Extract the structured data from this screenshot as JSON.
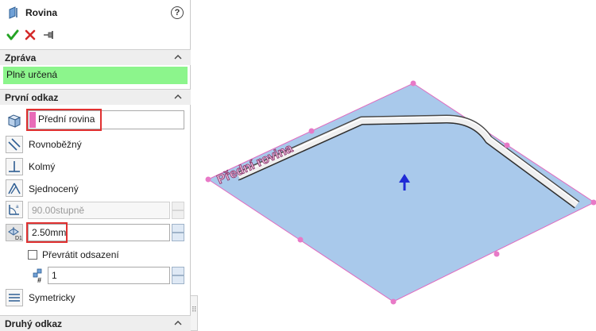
{
  "property_manager": {
    "title": "Rovina",
    "help_glyph": "?",
    "actions": {
      "ok": "✔",
      "cancel": "✖",
      "pin": "⊣"
    }
  },
  "sections": {
    "message": {
      "label": "Zpráva",
      "status_text": "Plně určená",
      "status_color": "#8cf58c"
    },
    "first_reference": {
      "label": "První odkaz",
      "reference_value": "Přední rovina",
      "options": {
        "parallel": "Rovnoběžný",
        "perpendicular": "Kolmý",
        "coincident": "Sjednocený"
      },
      "angle_value": "90.00stupně",
      "offset_value": "2.50mm",
      "flip_offset_label": "Převrátit odsazení",
      "flip_offset_checked": false,
      "instance_count": "1",
      "mid_plane_label": "Symetricky"
    },
    "second_reference": {
      "label": "Druhý odkaz"
    }
  },
  "viewport": {
    "plane_label": "Přední rovina",
    "plane_fill": "#a4c6ea",
    "plane_edge": "#e06bbf",
    "handle_color": "#e879c7",
    "normal_arrow_color": "#1f2ad6"
  }
}
